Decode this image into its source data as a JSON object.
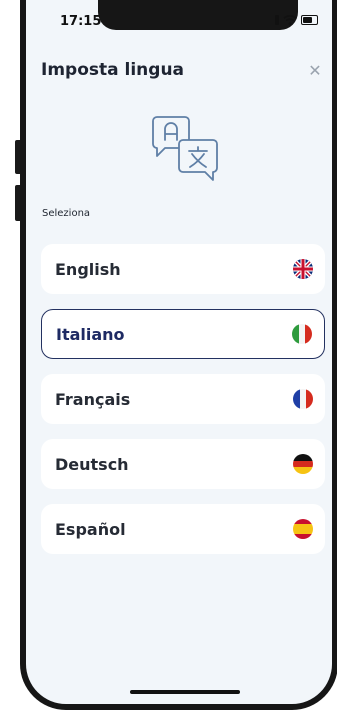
{
  "status_bar": {
    "time": "17:15"
  },
  "header": {
    "title": "Imposta lingua",
    "close_icon": "close-icon"
  },
  "section_label": "Seleziona",
  "languages": [
    {
      "label": "English",
      "flag": "uk-flag-icon",
      "selected": false
    },
    {
      "label": "Italiano",
      "flag": "italy-flag-icon",
      "selected": true
    },
    {
      "label": "Français",
      "flag": "france-flag-icon",
      "selected": false
    },
    {
      "label": "Deutsch",
      "flag": "germany-flag-icon",
      "selected": false
    },
    {
      "label": "Español",
      "flag": "spain-flag-icon",
      "selected": false
    }
  ],
  "colors": {
    "background": "#f2f6fa",
    "selected_border": "#233160",
    "icon_accent": "#5f7fa6"
  }
}
